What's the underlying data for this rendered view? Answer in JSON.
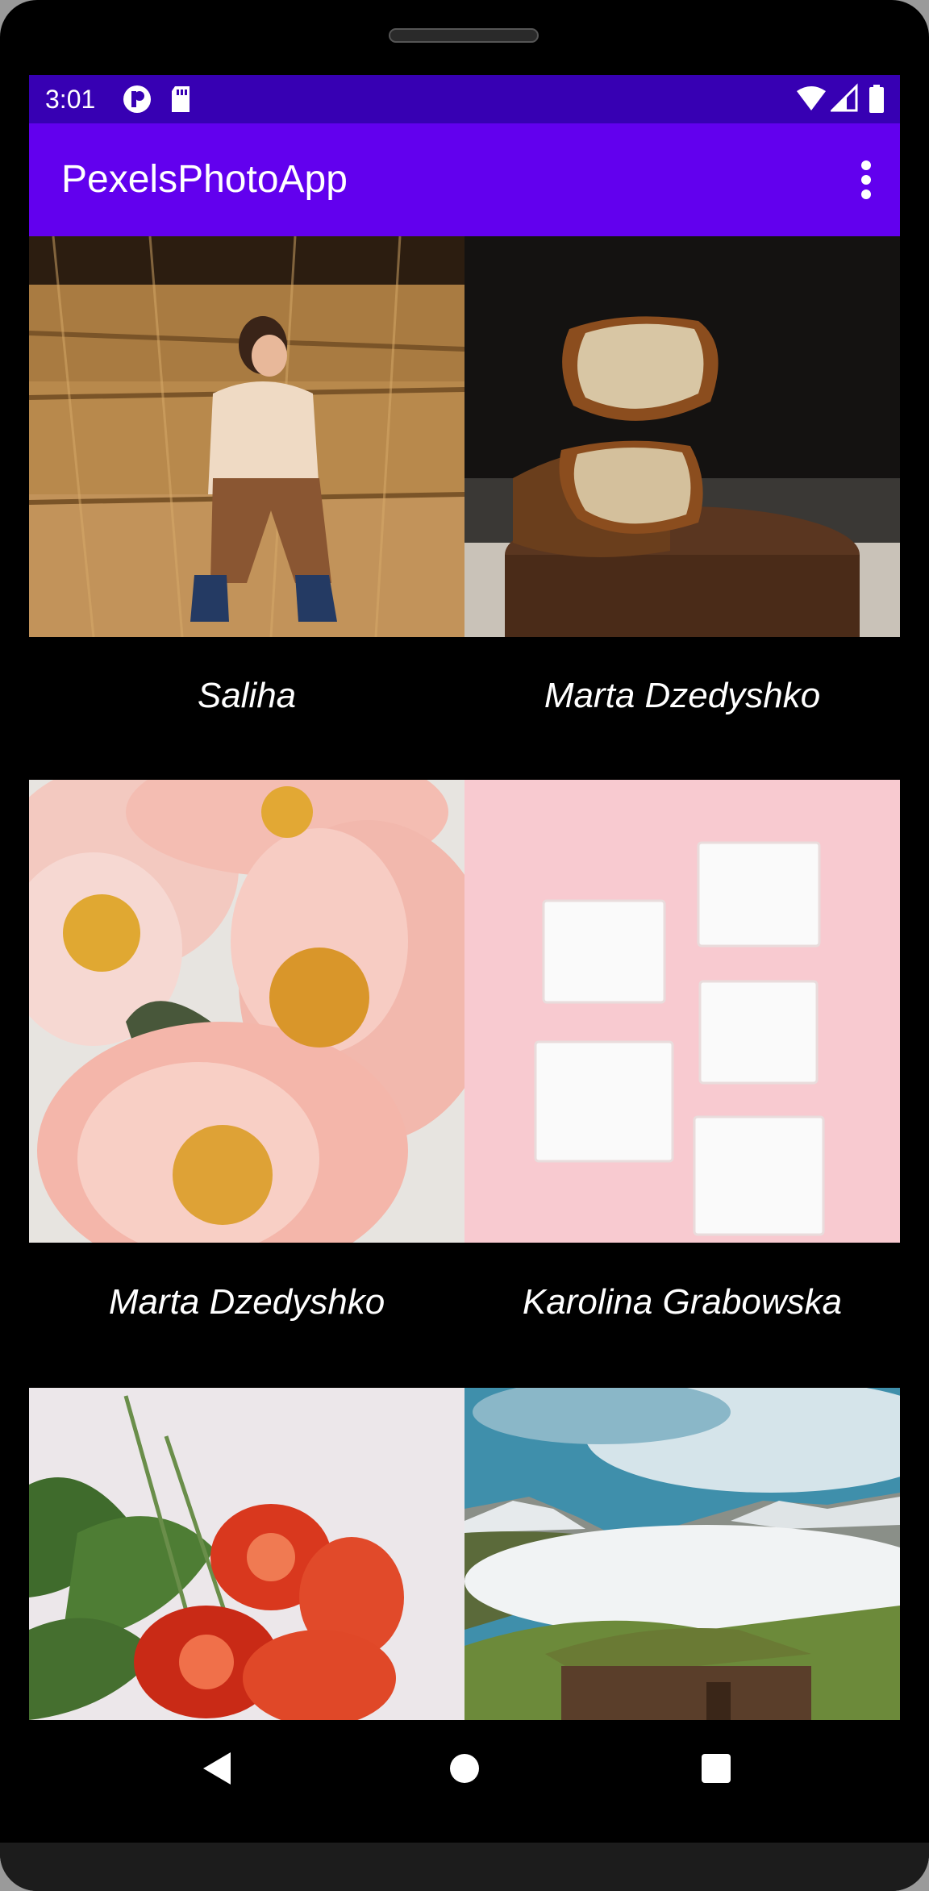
{
  "status_bar": {
    "time": "3:01",
    "left_icons": [
      "app-notification-icon",
      "sd-card-icon"
    ],
    "right_icons": [
      "wifi-icon",
      "cellular-signal-icon",
      "battery-icon"
    ]
  },
  "app_bar": {
    "title": "PexelsPhotoApp",
    "menu_icon": "more-vert-icon",
    "color": "#6200ee",
    "status_color": "#3700b3"
  },
  "photos": [
    {
      "photographer": "Saliha",
      "subject": "child-on-hay-bales"
    },
    {
      "photographer": "Marta Dzedyshko",
      "subject": "bread-on-wooden-board"
    },
    {
      "photographer": "Marta Dzedyshko",
      "subject": "pink-peonies"
    },
    {
      "photographer": "Karolina Grabowska",
      "subject": "pads-on-pink-background"
    },
    {
      "photographer": "",
      "subject": "sliced-tomatoes-arugula"
    },
    {
      "photographer": "",
      "subject": "mountain-hut-clouds"
    }
  ],
  "nav_bar": {
    "buttons": [
      "back-icon",
      "home-icon",
      "recents-icon"
    ]
  }
}
